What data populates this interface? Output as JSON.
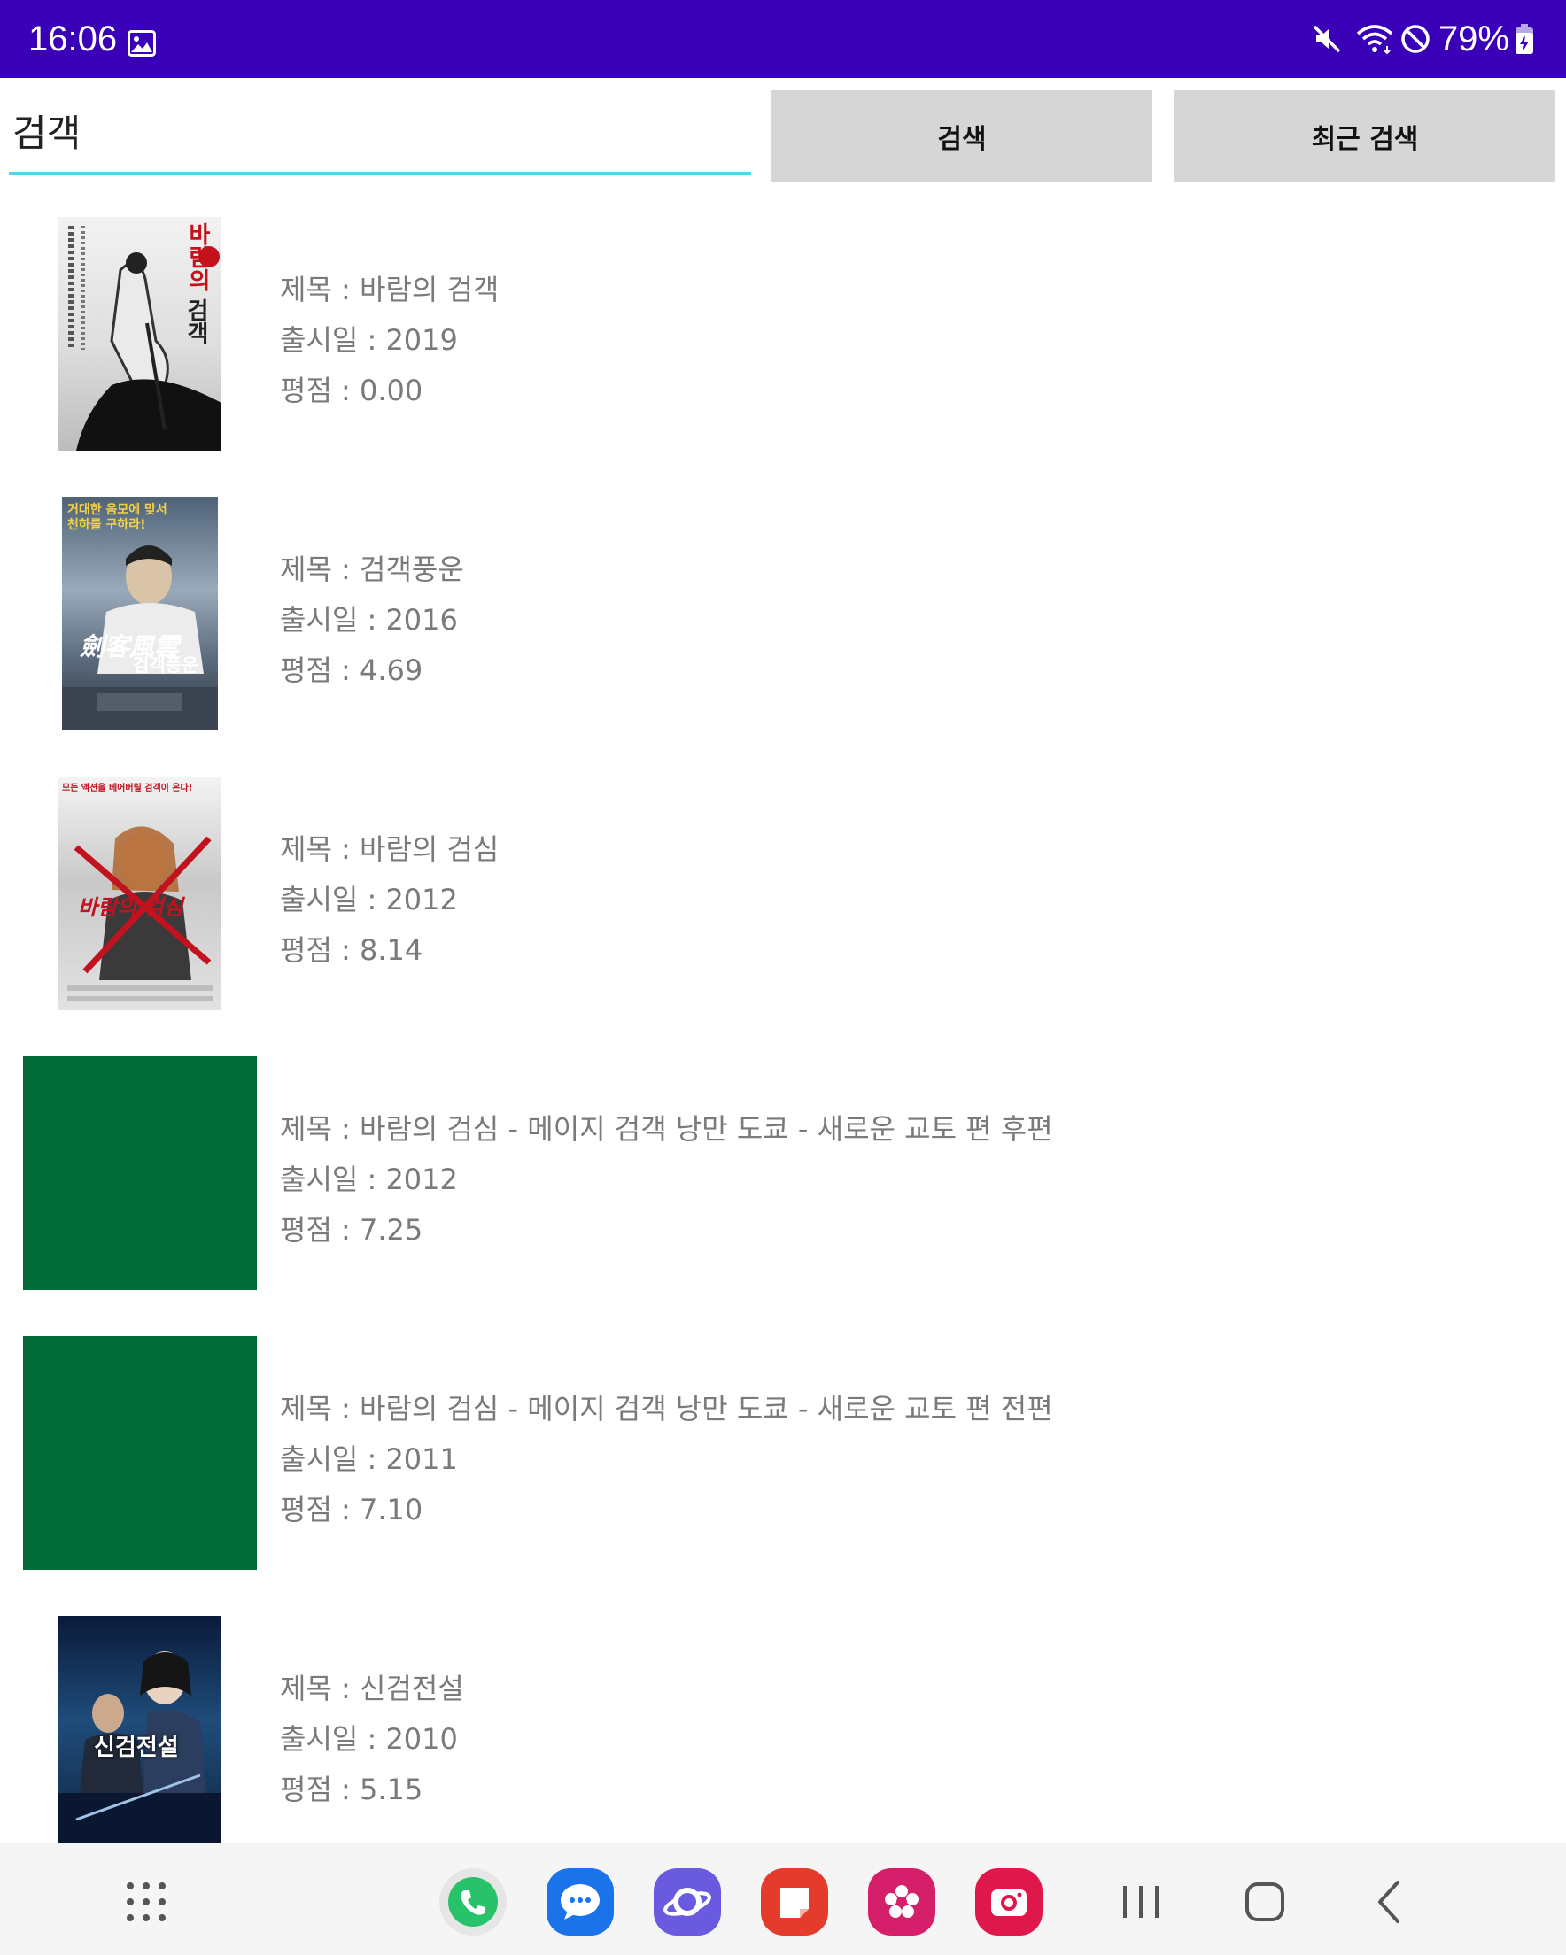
{
  "status_bar": {
    "time": "16:06",
    "battery": "79%",
    "icons": [
      "gallery-icon",
      "mute-icon",
      "wifi-icon",
      "do-not-disturb-icon",
      "battery-icon"
    ]
  },
  "search": {
    "query": "검객",
    "search_button": "검색",
    "recent_button": "최근 검색"
  },
  "movies": [
    {
      "title": "제목 : 바람의 검객",
      "release": "출시일 : 2019",
      "rating": "평점 : 0.00",
      "poster_text": [
        "바람의",
        "검객"
      ]
    },
    {
      "title": "제목 : 검객풍운",
      "release": "출시일 : 2016",
      "rating": "평점 : 4.69",
      "poster_text": [
        "거대한 음모에 맞서",
        "천하를 구하라!",
        "劍客風雲",
        "검객풍운"
      ]
    },
    {
      "title": "제목 : 바람의 검심",
      "release": "출시일 : 2012",
      "rating": "평점 : 8.14",
      "poster_text": [
        "모든 액션을 베어버릴 검객이 온다!",
        "바람의 검심"
      ]
    },
    {
      "title": "제목 : 바람의 검심 - 메이지 검객 낭만 도쿄 - 새로운 교토 편 후편",
      "release": "출시일 : 2012",
      "rating": "평점 : 7.25",
      "poster_text": []
    },
    {
      "title": "제목 : 바람의 검심 - 메이지 검객 낭만 도쿄 - 새로운 교토 편 전편",
      "release": "출시일 : 2011",
      "rating": "평점 : 7.10",
      "poster_text": []
    },
    {
      "title": "제목 : 신검전설",
      "release": "출시일 : 2010",
      "rating": "평점 : 5.15",
      "poster_text": [
        "신검전설"
      ]
    }
  ],
  "colors": {
    "status_bar": "#3a00b8",
    "input_underline": "#4dd6e6",
    "button_bg": "#d6d6d6",
    "placeholder_poster": "#006b36"
  },
  "nav_bar": {
    "items": [
      "apps-grid-icon",
      "phone-icon",
      "messages-icon",
      "internet-icon",
      "notes-icon",
      "gallery-app-icon",
      "camera-icon",
      "recents-icon",
      "home-icon",
      "back-icon"
    ]
  }
}
